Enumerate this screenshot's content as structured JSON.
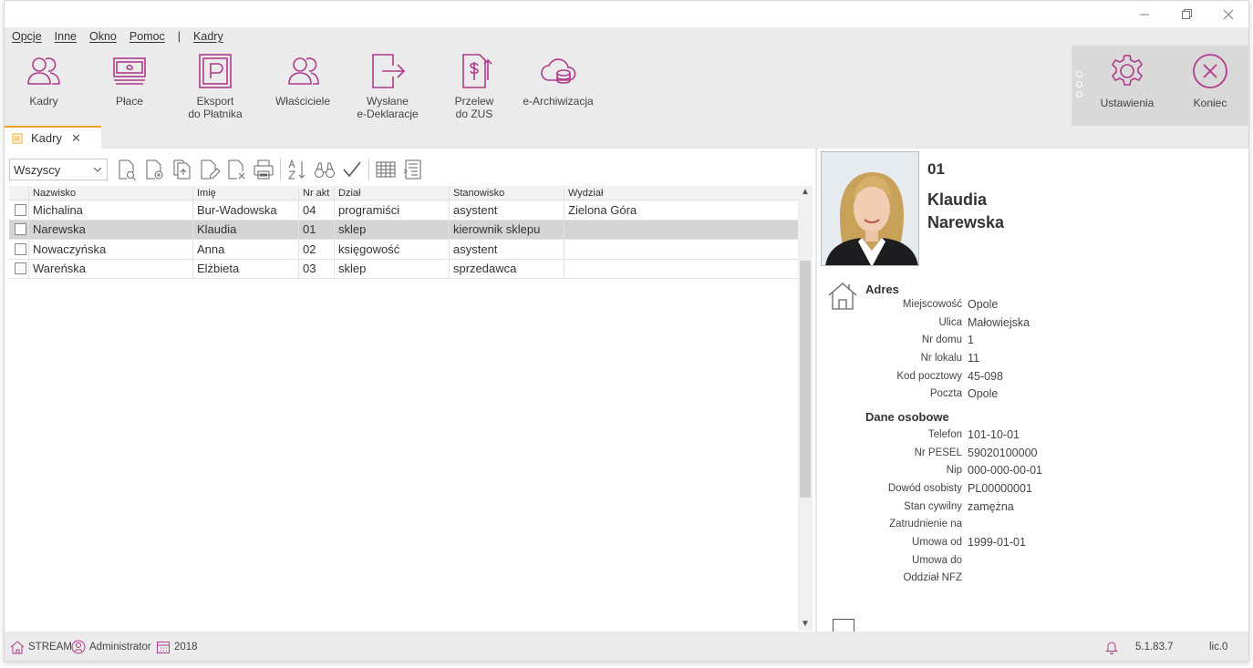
{
  "menu": {
    "items": [
      "Opcje",
      "Inne",
      "Okno",
      "Pomoc"
    ],
    "separator": "|",
    "module": "Kadry"
  },
  "ribbon": {
    "buttons": [
      {
        "label": "Kadry",
        "icon": "people-icon"
      },
      {
        "label": "Płace",
        "icon": "money-icon"
      },
      {
        "label": "Eksport\ndo Płatnika",
        "icon": "platnik-icon"
      },
      {
        "label": "Właściciele",
        "icon": "owners-icon"
      },
      {
        "label": "Wysłane\ne-Deklaracje",
        "icon": "send-icon"
      },
      {
        "label": "Przelew\ndo ZUS",
        "icon": "transfer-icon"
      },
      {
        "label": "e-Archiwizacja",
        "icon": "cloud-archive-icon"
      }
    ],
    "settings_label": "Ustawienia",
    "exit_label": "Koniec"
  },
  "tab": {
    "label": "Kadry",
    "close": "✕"
  },
  "filter": {
    "value": "Wszyscy"
  },
  "table": {
    "headers": [
      "Nazwisko",
      "Imię",
      "Nr akt",
      "Dział",
      "Stanowisko",
      "Wydział"
    ],
    "rows": [
      {
        "nazwisko": "Michalina",
        "imie": "Bur-Wadowska",
        "nr": "04",
        "dzial": "programiści",
        "stanowisko": "asystent",
        "wydzial": "Zielona Góra"
      },
      {
        "nazwisko": "Narewska",
        "imie": "Klaudia",
        "nr": "01",
        "dzial": "sklep",
        "stanowisko": "kierownik sklepu",
        "wydzial": ""
      },
      {
        "nazwisko": "Nowaczyńska",
        "imie": "Anna",
        "nr": "02",
        "dzial": "księgowość",
        "stanowisko": "asystent",
        "wydzial": ""
      },
      {
        "nazwisko": "Wareńska",
        "imie": "Elżbieta",
        "nr": "03",
        "dzial": "sklep",
        "stanowisko": "sprzedawca",
        "wydzial": ""
      }
    ],
    "selected_row": 1
  },
  "detail": {
    "nr_akt": "01",
    "first_name": "Klaudia",
    "last_name": "Narewska",
    "address_title": "Adres",
    "address": [
      {
        "label": "Miejscowość",
        "value": "Opole"
      },
      {
        "label": "Ulica",
        "value": "Małowiejska"
      },
      {
        "label": "Nr domu",
        "value": "1"
      },
      {
        "label": "Nr lokalu",
        "value": "11"
      },
      {
        "label": "Kod pocztowy",
        "value": "45-098"
      },
      {
        "label": "Poczta",
        "value": "Opole"
      }
    ],
    "personal_title": "Dane osobowe",
    "personal": [
      {
        "label": "Telefon",
        "value": "101-10-01"
      },
      {
        "label": "Nr PESEL",
        "value": "59020100000"
      },
      {
        "label": "Nip",
        "value": "000-000-00-01"
      },
      {
        "label": "Dowód osobisty",
        "value": "PL00000001"
      },
      {
        "label": "Stan cywilny",
        "value": "zamężna"
      },
      {
        "label": "Zatrudnienie na",
        "value": ""
      },
      {
        "label": "Umowa od",
        "value": "1999-01-01"
      },
      {
        "label": "Umowa do",
        "value": ""
      },
      {
        "label": "Oddział NFZ",
        "value": ""
      }
    ]
  },
  "status": {
    "company": "STREAM",
    "user": "Administrator",
    "year": "2018",
    "version": "5.1.83.7",
    "license": "lic.0"
  },
  "colors": {
    "accent": "#b03a8c",
    "tab_accent": "#f0a020",
    "selected_row": "#d4d4d4"
  }
}
